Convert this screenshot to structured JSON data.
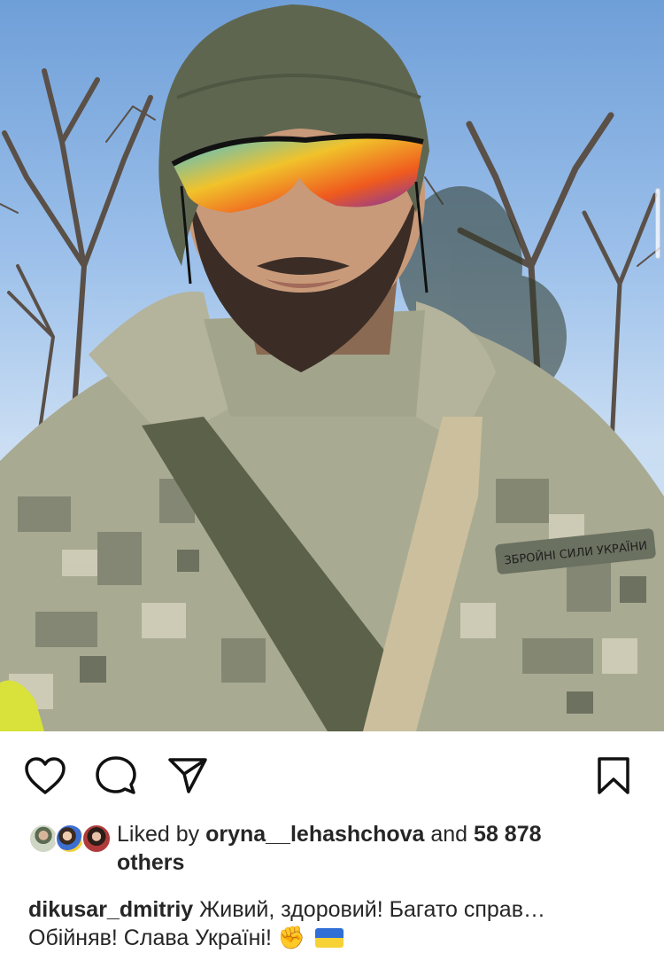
{
  "post": {
    "photo_icon": "selfie-photo",
    "actions": {
      "like_icon": "heart-outline-icon",
      "comment_icon": "comment-bubble-icon",
      "share_icon": "paper-plane-icon",
      "save_icon": "bookmark-outline-icon"
    },
    "likes": {
      "prefix": "Liked by",
      "user": "oryna__lehashchova",
      "middle": "and",
      "count": "58 878",
      "suffix": "others"
    },
    "caption": {
      "username": "dikusar_dmitriy",
      "line1": "Живий, здоровий! Багато справ…",
      "line2": "Обійняв! Слава Україні!",
      "emoji1": "✊"
    },
    "patch_text": "ЗБРОЙНІ СИЛИ УКРАЇНИ"
  }
}
